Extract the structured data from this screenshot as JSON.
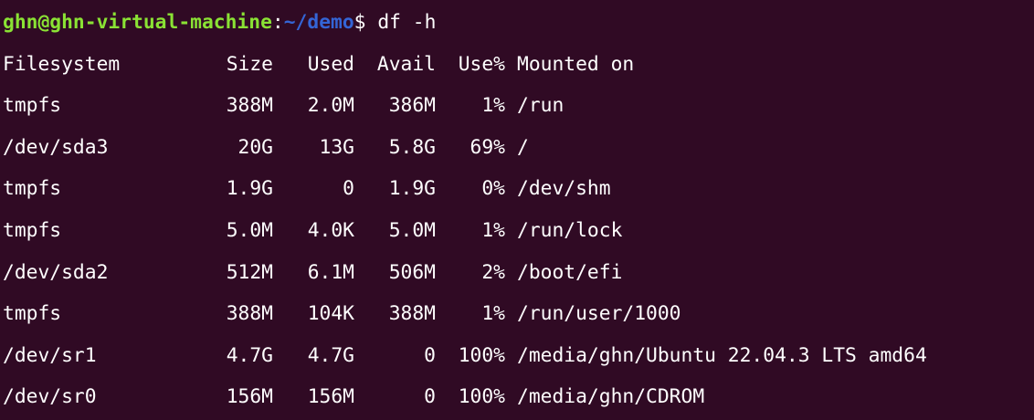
{
  "terminal": {
    "prompt": {
      "user_host": "ghn@ghn-virtual-machine",
      "colon": ":",
      "path": "~/demo",
      "dollar": "$",
      "command": " df -h"
    },
    "colors": {
      "background": "#300a24",
      "prompt_user": "#8ae234",
      "prompt_path": "#3465d6",
      "text": "#ffffff"
    },
    "table": {
      "headers": [
        "Filesystem",
        "Size",
        "Used",
        "Avail",
        "Use%",
        "Mounted on"
      ],
      "rows": [
        [
          "tmpfs",
          "388M",
          "2.0M",
          "386M",
          "1%",
          "/run"
        ],
        [
          "/dev/sda3",
          "20G",
          "13G",
          "5.8G",
          "69%",
          "/"
        ],
        [
          "tmpfs",
          "1.9G",
          "0",
          "1.9G",
          "0%",
          "/dev/shm"
        ],
        [
          "tmpfs",
          "5.0M",
          "4.0K",
          "5.0M",
          "1%",
          "/run/lock"
        ],
        [
          "/dev/sda2",
          "512M",
          "6.1M",
          "506M",
          "2%",
          "/boot/efi"
        ],
        [
          "tmpfs",
          "388M",
          "104K",
          "388M",
          "1%",
          "/run/user/1000"
        ],
        [
          "/dev/sr1",
          "4.7G",
          "4.7G",
          "0",
          "100%",
          "/media/ghn/Ubuntu 22.04.3 LTS amd64"
        ],
        [
          "/dev/sr0",
          "156M",
          "156M",
          "0",
          "100%",
          "/media/ghn/CDROM"
        ]
      ]
    }
  }
}
